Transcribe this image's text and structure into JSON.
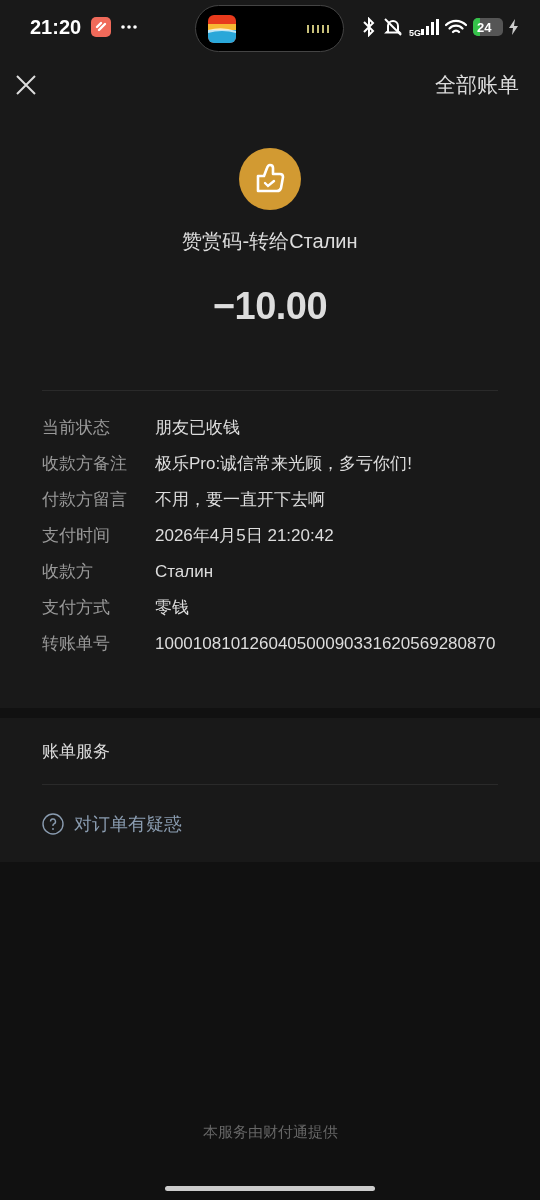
{
  "status_bar": {
    "time": "21:20",
    "network": "5G",
    "battery": "24"
  },
  "nav": {
    "right_link": "全部账单"
  },
  "header": {
    "title": "赞赏码-转给Сталин",
    "amount": "−10.00"
  },
  "details": [
    {
      "label": "当前状态",
      "value": "朋友已收钱"
    },
    {
      "label": "收款方备注",
      "value": "极乐Pro:诚信常来光顾，多亏你们!"
    },
    {
      "label": "付款方留言",
      "value": "不用，要一直开下去啊"
    },
    {
      "label": "支付时间",
      "value": "2026年4月5日 21:20:42"
    },
    {
      "label": "收款方",
      "value": "Сталин"
    },
    {
      "label": "支付方式",
      "value": "零钱"
    },
    {
      "label": "转账单号",
      "value": "100010810126040500090331620569280870"
    }
  ],
  "services": {
    "title": "账单服务",
    "items": [
      {
        "label": "对订单有疑惑"
      }
    ]
  },
  "footer": "本服务由财付通提供"
}
